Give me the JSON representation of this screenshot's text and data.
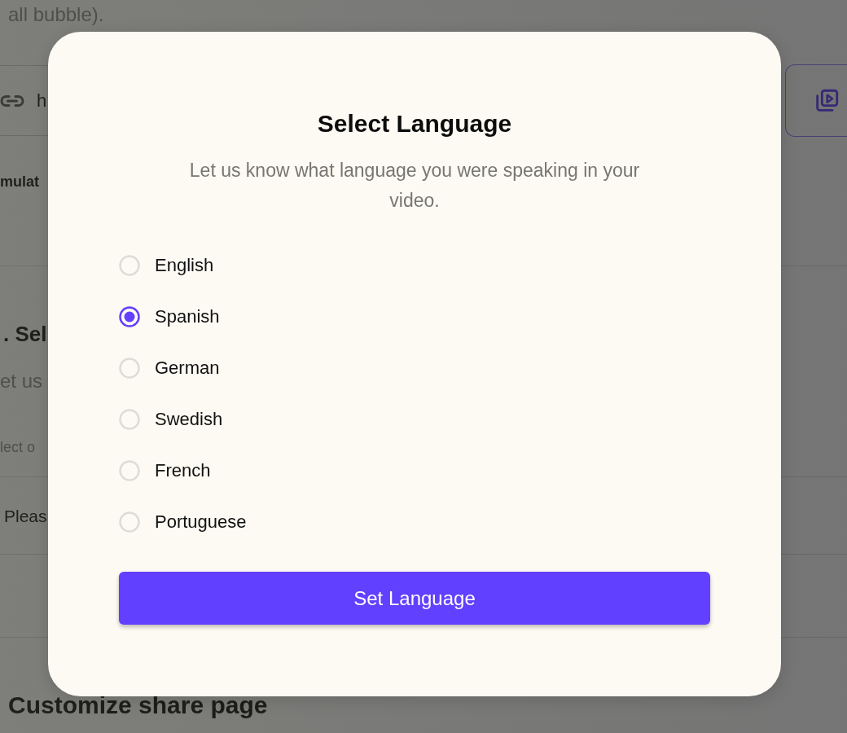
{
  "page": {
    "caption_fragment": "all bubble).",
    "link_field": {
      "value": "h"
    },
    "option_fragment": "mulat",
    "section_heading_fragment": ". Sel",
    "section_text_fragment": "et us",
    "hint_fragment": "lect o",
    "prompt_fragment": "Pleas",
    "next_heading": "Customize share page"
  },
  "dialog": {
    "title": "Select Language",
    "subtitle": "Let us know what language you were speaking in your video.",
    "options": [
      {
        "label": "English",
        "selected": false
      },
      {
        "label": "Spanish",
        "selected": true
      },
      {
        "label": "German",
        "selected": false
      },
      {
        "label": "Swedish",
        "selected": false
      },
      {
        "label": "French",
        "selected": false
      },
      {
        "label": "Portuguese",
        "selected": false
      }
    ],
    "button": "Set Language"
  }
}
